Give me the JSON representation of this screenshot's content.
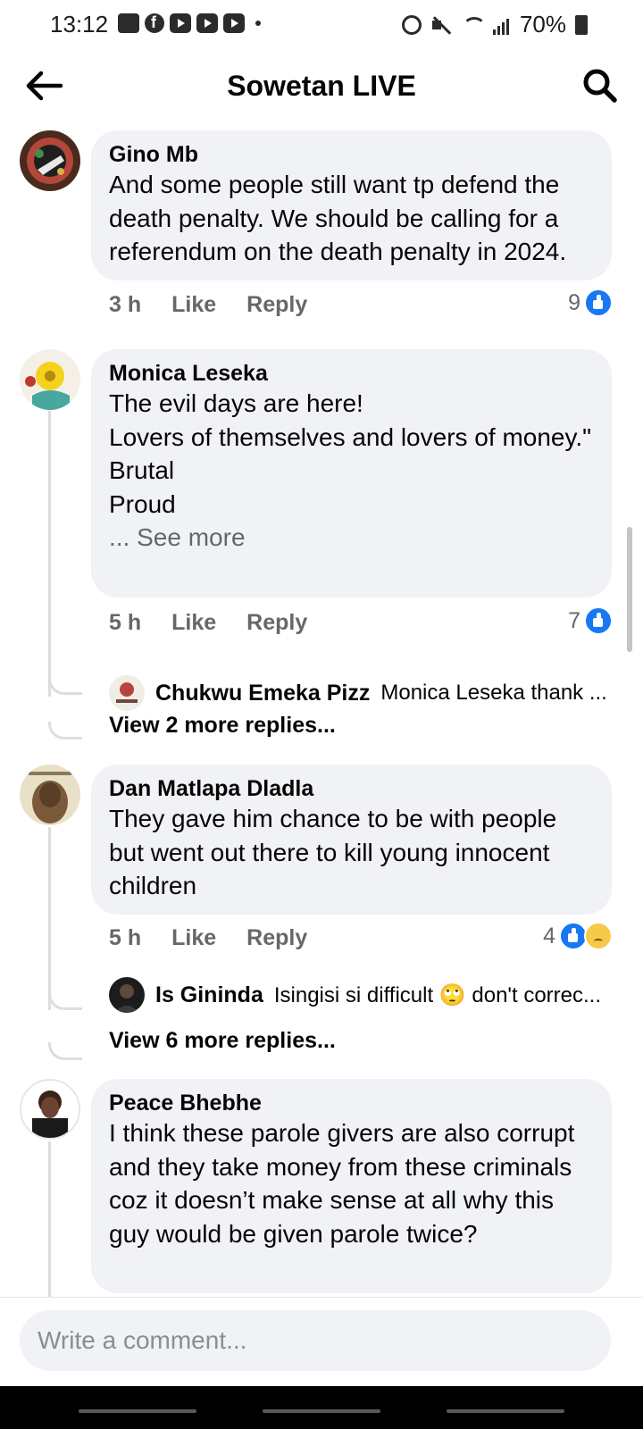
{
  "status_bar": {
    "time": "13:12",
    "battery": "70%"
  },
  "header": {
    "title": "Sowetan LIVE"
  },
  "comments": [
    {
      "author": "Gino Mb",
      "text": "And some people still want tp defend the death penalty. We should be calling for a referendum on the death penalty in 2024.",
      "time": "3 h",
      "like_label": "Like",
      "reply_label": "Reply",
      "reaction_count": "9"
    },
    {
      "author": "Monica Leseka",
      "text": "The evil days are here!\nLovers of themselves and lovers of money.\"\nBrutal\nProud",
      "see_more": "... See more",
      "time": "5 h",
      "like_label": "Like",
      "reply_label": "Reply",
      "reaction_count": "7",
      "reply_preview": {
        "name": "Chukwu Emeka Pizz",
        "snippet": "Monica Leseka  thank ..."
      },
      "view_more": "View 2 more replies..."
    },
    {
      "author": "Dan Matlapa Dladla",
      "text": "They gave him chance to be with people but went out there to kill young innocent children",
      "time": "5 h",
      "like_label": "Like",
      "reply_label": "Reply",
      "reaction_count": "4",
      "reply_preview": {
        "name": "Is Gininda",
        "snippet": "Isingisi si difficult 🙄 don't correc..."
      },
      "view_more": "View 6 more replies..."
    },
    {
      "author": "Peace Bhebhe",
      "text": "I think these parole givers are also corrupt and they take money from these criminals coz it doesn’t make sense at all why this guy would be given parole twice?"
    }
  ],
  "composer": {
    "placeholder": "Write a comment..."
  }
}
